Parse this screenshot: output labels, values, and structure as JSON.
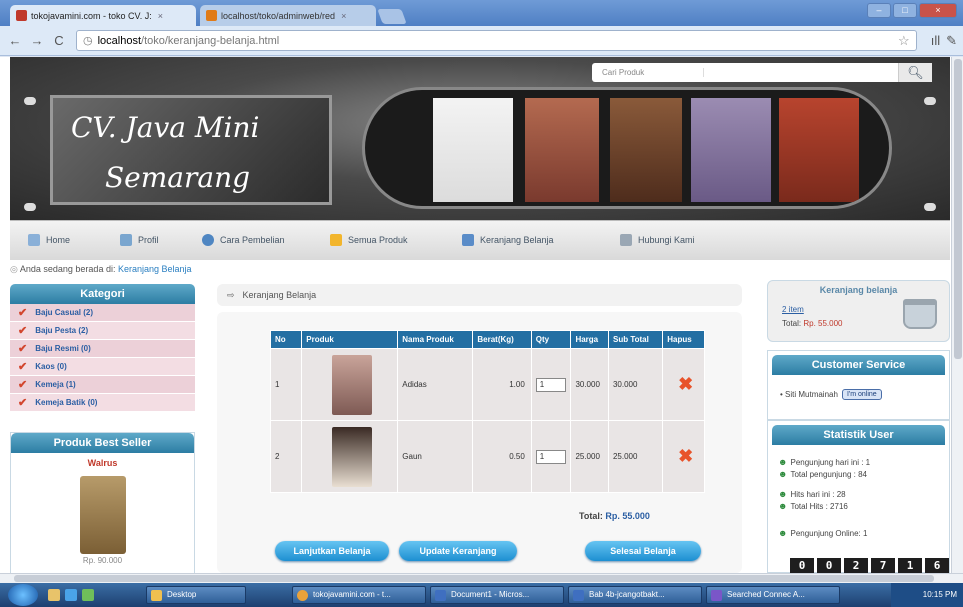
{
  "browser": {
    "tabs": [
      {
        "label": "tokojavamini.com - toko CV. J:",
        "active": true
      },
      {
        "label": "localhost/toko/adminweb/red",
        "active": false
      }
    ],
    "url_host": "localhost",
    "url_path": "/toko/keranjang-belanja.html"
  },
  "header": {
    "search_placeholder": "Cari Produk",
    "logo_line1": "CV. Java Mini",
    "logo_line2": "Semarang"
  },
  "menu": [
    {
      "label": "Home",
      "icon": "home-icon"
    },
    {
      "label": "Profil",
      "icon": "profile-icon"
    },
    {
      "label": "Cara Pembelian",
      "icon": "help-icon"
    },
    {
      "label": "Semua Produk",
      "icon": "star-icon"
    },
    {
      "label": "Keranjang Belanja",
      "icon": "car-icon"
    },
    {
      "label": "Hubungi Kami",
      "icon": "contact-icon"
    }
  ],
  "breadcrumb": {
    "prefix": "Anda sedang berada di:",
    "current": "Keranjang Belanja"
  },
  "kategori": {
    "title": "Kategori",
    "items": [
      "Baju Casual (2)",
      "Baju Pesta (2)",
      "Baju Resmi (0)",
      "Kaos (0)",
      "Kemeja (1)",
      "Kemeja Batik (0)"
    ]
  },
  "best_seller": {
    "title": "Produk Best Seller",
    "name": "Walrus",
    "price": "Rp. 90.000"
  },
  "content": {
    "title": "Keranjang Belanja",
    "columns": [
      "No",
      "Produk",
      "Nama Produk",
      "Berat(Kg)",
      "Qty",
      "Harga",
      "Sub Total",
      "Hapus"
    ],
    "rows": [
      {
        "no": "1",
        "nama": "Adidas",
        "berat": "1.00",
        "qty": "1",
        "harga": "30.000",
        "subtotal": "30.000"
      },
      {
        "no": "2",
        "nama": "Gaun",
        "berat": "0.50",
        "qty": "1",
        "harga": "25.000",
        "subtotal": "25.000"
      }
    ],
    "total_label": "Total:",
    "total_value": "Rp. 55.000",
    "buttons": {
      "continue": "Lanjutkan Belanja",
      "update": "Update Keranjang",
      "checkout": "Selesai Belanja"
    }
  },
  "cart_box": {
    "title": "Keranjang belanja",
    "items": "2 item",
    "total_label": "Total:",
    "total_value": "Rp. 55.000"
  },
  "customer_service": {
    "title": "Customer Service",
    "name": "• Siti Mutmainah",
    "status": "I'm online"
  },
  "statistik": {
    "title": "Statistik User",
    "lines": [
      "Pengunjung hari ini : 1",
      "Total pengunjung : 84",
      "Hits hari ini : 28",
      "Total Hits : 2716",
      "Pengunjung Online: 1"
    ],
    "counter": [
      "0",
      "0",
      "2",
      "7",
      "1",
      "6"
    ]
  },
  "taskbar": {
    "items": [
      "Desktop",
      "tokojavamini.com - t...",
      "Document1 - Micros...",
      "Bab 4b-jcangotbakt...",
      "Searched Connec A..."
    ],
    "clock": "10:15 PM"
  }
}
